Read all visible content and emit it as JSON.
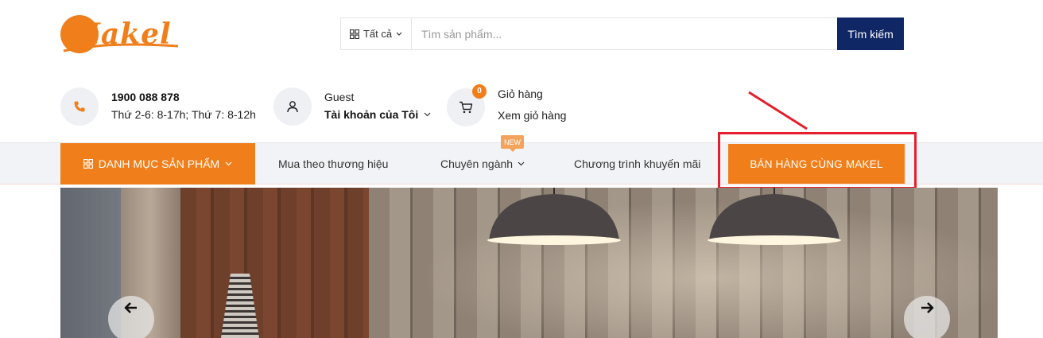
{
  "logo": {
    "text": "Makel"
  },
  "search": {
    "category_label": "Tất cả",
    "placeholder": "Tìm sản phẩm...",
    "button_label": "Tìm kiếm"
  },
  "contact": {
    "phone": "1900 088 878",
    "hours": "Thứ 2-6: 8-17h; Thứ 7: 8-12h"
  },
  "account": {
    "greeting": "Guest",
    "label": "Tài khoản của Tôi"
  },
  "cart": {
    "count": "0",
    "label": "Giỏ hàng",
    "view_label": "Xem giỏ hàng"
  },
  "nav": {
    "categories_label": "DANH MỤC SẢN PHẨM",
    "brand_label": "Mua theo thương hiệu",
    "industry_label": "Chuyên ngành",
    "new_badge": "NEW",
    "promo_label": "Chương trình khuyến mãi",
    "sell_label": "BÁN HÀNG CÙNG MAKEL"
  },
  "colors": {
    "accent": "#f07f1b",
    "navy": "#0f2765",
    "highlight_red": "#e3202c"
  }
}
